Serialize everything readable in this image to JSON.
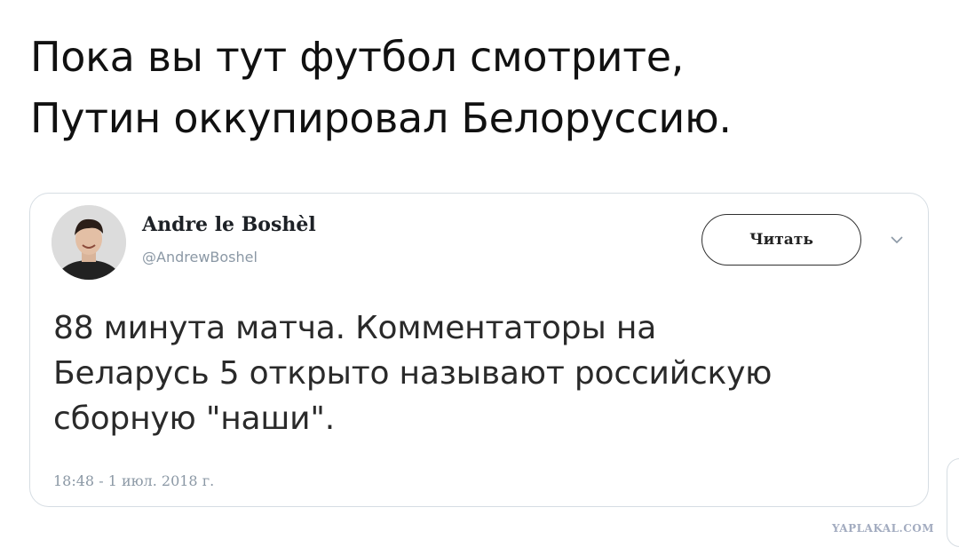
{
  "caption": {
    "line1": "Пока вы тут футбол смотрите,",
    "line2": "Путин оккупировал Белоруссию."
  },
  "tweet": {
    "author_name": "Andre le Boshèl",
    "author_handle": "@AndrewBoshel",
    "follow_label": "Читать",
    "text_lines": [
      "88 минута матча. Комментаторы на",
      "Беларусь 5 открыто называют российскую",
      "сборную \"наши\"."
    ],
    "timestamp": "18:48 - 1 июл. 2018 г."
  },
  "watermark": "YAPLAKAL.COM",
  "icons": {
    "avatar": "avatar-photo",
    "menu": "chevron-down-icon"
  },
  "colors": {
    "card_border": "#d6dde3",
    "meta_gray": "#8b98a5",
    "watermark": "#a3acc0"
  }
}
